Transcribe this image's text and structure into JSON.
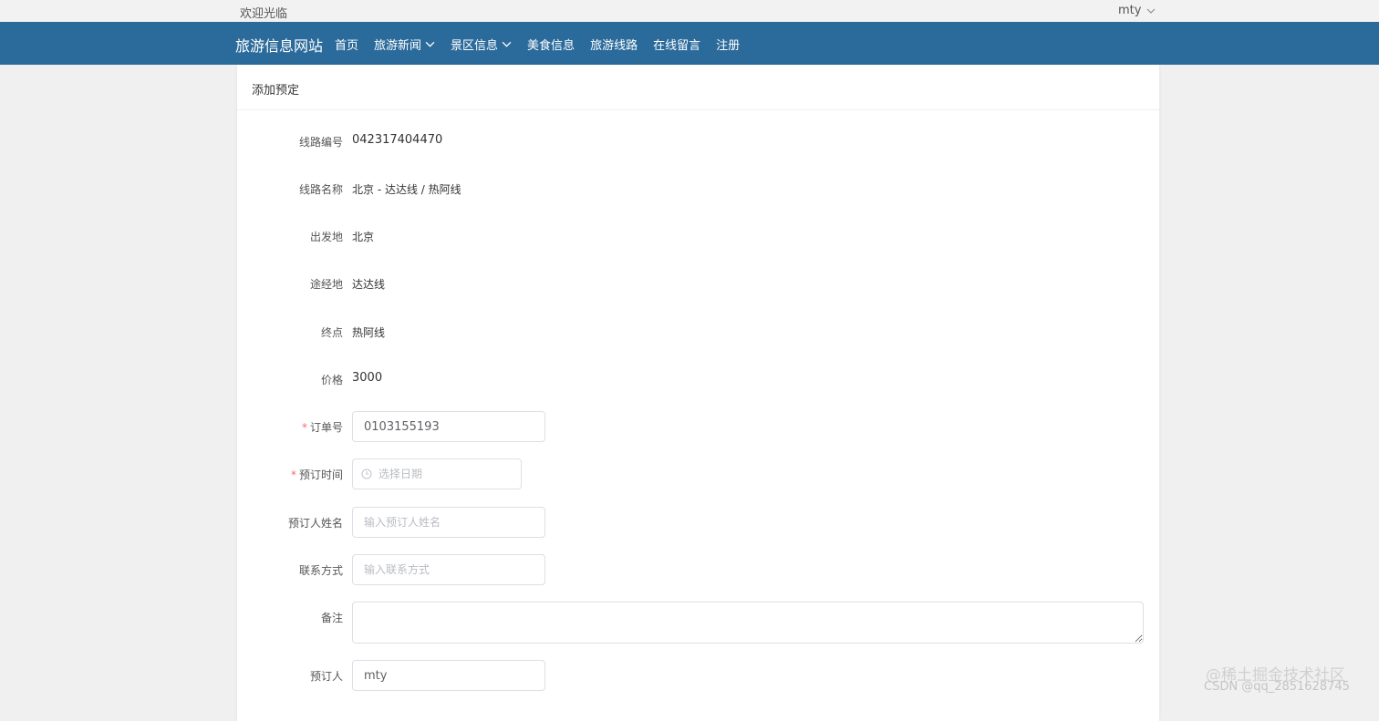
{
  "topbar": {
    "welcome": "欢迎光临",
    "username": "mty"
  },
  "navbar": {
    "brand": "旅游信息网站",
    "items": [
      {
        "label": "首页",
        "dropdown": false
      },
      {
        "label": "旅游新闻",
        "dropdown": true
      },
      {
        "label": "景区信息",
        "dropdown": true
      },
      {
        "label": "美食信息",
        "dropdown": false
      },
      {
        "label": "旅游线路",
        "dropdown": false
      },
      {
        "label": "在线留言",
        "dropdown": false
      },
      {
        "label": "注册",
        "dropdown": false
      }
    ]
  },
  "card": {
    "title": "添加预定"
  },
  "form": {
    "route_no": {
      "label": "线路编号",
      "value": "042317404470"
    },
    "route_name": {
      "label": "线路名称",
      "value": "北京 - 达达线 / 热阿线"
    },
    "departure": {
      "label": "出发地",
      "value": "北京"
    },
    "via": {
      "label": "途经地",
      "value": "达达线"
    },
    "destination": {
      "label": "终点",
      "value": "热阿线"
    },
    "price": {
      "label": "价格",
      "value": "3000"
    },
    "order_no": {
      "label": "订单号",
      "required": "*",
      "value": "0103155193"
    },
    "booking_time": {
      "label": "预订时间",
      "required": "*",
      "placeholder": "选择日期"
    },
    "booker_name": {
      "label": "预订人姓名",
      "placeholder": "输入预订人姓名"
    },
    "contact": {
      "label": "联系方式",
      "placeholder": "输入联系方式"
    },
    "remark": {
      "label": "备注",
      "value": ""
    },
    "booker": {
      "label": "预订人",
      "value": "mty"
    }
  },
  "watermark": {
    "line1": "@稀土掘金技术社区",
    "line2": "CSDN @qq_2851628745"
  },
  "colors": {
    "nav_bg": "#2b6b9c",
    "required": "#f56c6c",
    "page_bg": "#f0f0f0"
  }
}
